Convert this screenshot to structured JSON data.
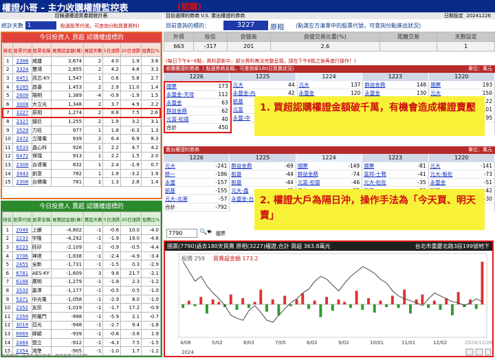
{
  "app": {
    "title": "權證小哥 - 主力收購權證監控表",
    "demo": "(認購)"
  },
  "header": {
    "left": "目錄選權證買賣超統計表",
    "right": "目前選擇的券商 V.S. 賣出權證的券商",
    "date_label": "日期設定",
    "date": "20241226"
  },
  "controls": {
    "days_label": "統計天數",
    "days_value": "1",
    "days_hint": "點選股票代號，可查詢分點買賣資料)",
    "query_label": "目前查詢的標的：",
    "query_code": "3227",
    "query_name": "原相",
    "query_hint": "(點選左方清單中的股票代號，可查詢分點進出狀況)"
  },
  "buy_panel": {
    "title": "今日投資人 買超 認購權證標的",
    "headers": [
      "排名",
      "股票代號",
      "股票名稱",
      "買賣超金額(萬)",
      "買超天數",
      "5日漲跌",
      "20日漲跌",
      "但賣比%"
    ],
    "rows": [
      [
        "1",
        "2388",
        "威盛",
        "3,674",
        "2",
        "4.0",
        "1.9",
        "3.6"
      ],
      [
        "2",
        "3324",
        "雙鴻",
        "2,855",
        "2",
        "4.2",
        "4.8",
        "3.3"
      ],
      [
        "3",
        "6451",
        "訊芯-KY",
        "1,547",
        "1",
        "0.6",
        "5.8",
        "2.7"
      ],
      [
        "4",
        "6285",
        "啟碁",
        "1,453",
        "2",
        "2.9",
        "11.0",
        "1.4"
      ],
      [
        "5",
        "2609",
        "陽明",
        "1,389",
        "-4",
        "-0.9",
        "-1.9",
        "1.5"
      ],
      [
        "6",
        "3008",
        "大立光",
        "1,348",
        "2",
        "3.7",
        "4.9",
        "2.2"
      ],
      [
        "7",
        "3227",
        "原相",
        "1,274",
        "2",
        "8.8",
        "7.5",
        "2.6"
      ],
      [
        "8",
        "2327",
        "國巨",
        "1,255",
        "2",
        "1.9",
        "3.2",
        "3.1"
      ],
      [
        "9",
        "3529",
        "力旺",
        "977",
        "1",
        "1.8",
        "-0.3",
        "1.3"
      ],
      [
        "10",
        "2472",
        "立隆電",
        "939",
        "2",
        "6.4",
        "6.9",
        "8.3"
      ],
      [
        "11",
        "6533",
        "晶心科",
        "926",
        "1",
        "2.2",
        "4.7",
        "4.2"
      ],
      [
        "12",
        "6472",
        "保瑞",
        "913",
        "1",
        "2.2",
        "1.5",
        "2.0"
      ],
      [
        "13",
        "2308",
        "台達電",
        "832",
        "1",
        "2.4",
        "-1.9",
        "0.7"
      ],
      [
        "14",
        "3443",
        "創意",
        "782",
        "1",
        "1.9",
        "-3.2",
        "1.9"
      ],
      [
        "15",
        "2308",
        "台積電",
        "781",
        "1",
        "1.3",
        "2.8",
        "1.4"
      ]
    ]
  },
  "sell_panel": {
    "title": "今日投資人 賣超 認購權證標的",
    "headers": [
      "排名",
      "股票代號",
      "股票名稱",
      "買賣超金額(萬)",
      "賣超天數",
      "5日漲跌",
      "20日漲跌",
      "但賣比%"
    ],
    "rows": [
      [
        "1",
        "2049",
        "上銀",
        "-4,802",
        "-1",
        "-0.6",
        "10.0",
        "-4.0"
      ],
      [
        "2",
        "2233",
        "宇隆",
        "-4,292",
        "-1",
        "-1.9",
        "19.0",
        "-4.6"
      ],
      [
        "3",
        "6223",
        "旺矽",
        "-2,109",
        "-1",
        "-0.9",
        "-0.5",
        "-4.4"
      ],
      [
        "4",
        "3706",
        "神達",
        "-1,838",
        "-1",
        "-2.4",
        "-4.9",
        "-3.4"
      ],
      [
        "5",
        "2455",
        "全新",
        "-1,731",
        "-1",
        "-1.5",
        "0.3",
        "-2.9"
      ],
      [
        "6",
        "6781",
        "AES-KY",
        "-1,609",
        "3",
        "9.8",
        "21.7",
        "-2.1"
      ],
      [
        "7",
        "6188",
        "廣明",
        "-1,279",
        "-1",
        "-1.8",
        "2.3",
        "-1.2"
      ],
      [
        "8",
        "3533",
        "嘉澤",
        "-1,177",
        "-1",
        "-0.5",
        "0.5",
        "-1.0"
      ],
      [
        "9",
        "5371",
        "中光電",
        "-1,058",
        "-1",
        "-2.9",
        "8.0",
        "-1.0"
      ],
      [
        "10",
        "2352",
        "友訊",
        "-1,019",
        "-1",
        "-1.7",
        "17.2",
        "-0.9"
      ],
      [
        "11",
        "2359",
        "所羅門",
        "-998",
        "-1",
        "-5.9",
        "2.1",
        "-0.7"
      ],
      [
        "12",
        "3019",
        "亞光",
        "-948",
        "-1",
        "-2.7",
        "9.4",
        "-1.8"
      ],
      [
        "13",
        "6669",
        "緯穎",
        "-939",
        "-1",
        "-0.6",
        "-3.8",
        "1.9"
      ],
      [
        "14",
        "2464",
        "盟立",
        "-912",
        "-1",
        "-4.3",
        "7.5",
        "-1.5"
      ],
      [
        "15",
        "2354",
        "鴻準",
        "-905",
        "-1",
        "-1.0",
        "1.7",
        "-1.2"
      ]
    ]
  },
  "summary": {
    "headers": [
      "外資",
      "投信",
      "自營商",
      "自營交易比重(%)",
      "距離交易",
      "天數設定"
    ],
    "values": [
      "663",
      "-317",
      "201",
      "2.6",
      "",
      "1"
    ]
  },
  "info_line": "(每日下午4~6點，資料更新中，部分資料無法完整呈現，請在下午6點之後再進行操作！)",
  "buy_brokers": {
    "title": "收購權證的券商",
    "subtitle": "( 點選券商名稱，可查詢單180日買賣狀況)",
    "unit": "單位：萬元",
    "dates": [
      "1226",
      "1225",
      "1224",
      "1223",
      "1220"
    ],
    "cols": [
      [
        [
          "國票",
          "173"
        ],
        [
          "永豐金-天母",
          "112"
        ],
        [
          "永豐金",
          "63"
        ],
        [
          "群益金鼎",
          "62"
        ],
        [
          "元富-松德",
          "40"
        ],
        [
          "合計",
          "450"
        ]
      ],
      [
        [
          "元大",
          "44"
        ],
        [
          "永豐金-內",
          "42"
        ],
        [
          "凱基",
          "41"
        ],
        [
          "元富",
          "38"
        ],
        [
          "永豐-中",
          "33"
        ]
      ],
      [
        [
          "元大",
          "137"
        ],
        [
          "永豐金",
          "120"
        ],
        [
          "凱基",
          "110"
        ],
        [
          "國票",
          "96"
        ],
        [
          "元富",
          "80"
        ]
      ],
      [
        [
          "群益金鼎",
          "148"
        ],
        [
          "永豐金",
          "130"
        ],
        [
          "國票",
          "118"
        ],
        [
          "元大",
          "99"
        ],
        [
          "凱基",
          "88"
        ]
      ],
      [
        [
          "國票",
          "193"
        ],
        [
          "元大",
          "150"
        ],
        [
          "群益",
          "122"
        ],
        [
          "永豐",
          "101"
        ],
        [
          "凱基",
          "95"
        ]
      ]
    ]
  },
  "sell_brokers": {
    "title": "賣出權證的券商",
    "unit": "單位：萬元",
    "dates": [
      "1226",
      "1225",
      "1224",
      "1223",
      "1220"
    ],
    "cols": [
      [
        [
          "元大",
          "-241"
        ],
        [
          "統一",
          "-186"
        ],
        [
          "永豐",
          "-157"
        ],
        [
          "凱基",
          "-155"
        ],
        [
          "元大-北港",
          "-57"
        ],
        [
          "合計",
          "-792"
        ]
      ],
      [
        [
          "群益金鼎",
          "-69"
        ],
        [
          "凱基",
          "-44"
        ],
        [
          "凱基",
          "-44"
        ],
        [
          "元大-鑫",
          "-41"
        ],
        [
          "永豐金-台",
          "-30"
        ]
      ],
      [
        [
          "國票",
          "-149"
        ],
        [
          "群益金鼎",
          "-74"
        ],
        [
          "元富-松德",
          "-46"
        ],
        [
          "元大",
          "-35"
        ],
        [
          "凱基",
          "-28"
        ]
      ],
      [
        [
          "國票",
          "-81"
        ],
        [
          "富邦-士賢",
          "-41"
        ],
        [
          "元大-松佐",
          "-35"
        ],
        [
          "凱基",
          "-30"
        ],
        [
          "永豐金",
          "-22"
        ]
      ],
      [
        [
          "元大",
          "-141"
        ],
        [
          "元大-板佐",
          "-73"
        ],
        [
          "永豐金",
          "-51"
        ],
        [
          "凱基",
          "-42"
        ],
        [
          "國票",
          "-30"
        ]
      ]
    ]
  },
  "callouts": {
    "one": "1. 買超認購權證金額破千萬，有機會造成權證賣壓",
    "two": "2.  權證大戶為隔日沖，操作手法為「今天買、明天賣」"
  },
  "search": {
    "value": "7790",
    "label": "國票"
  },
  "chart": {
    "title": "國票(7790)過去180天買賣 原相(3227)權證,合計  買超 363.8萬元",
    "address": "台北市重慶北路3段199號地下",
    "legend_stock": "股價 259",
    "legend_amount": "買賣超金額 173.2",
    "year": "2024",
    "x_labels": [
      "4/08",
      "5/02",
      "6/03",
      "7/05",
      "8/02",
      "9/02",
      "10/01",
      "11/01",
      "12/02",
      "2024/12/26"
    ]
  },
  "footer": "免責聲明：此資料僅供參考，使用者應自行判斷",
  "colors": {
    "topbar": "#0a2a8a",
    "buy": "#e1413a",
    "sell": "#2b8a2b",
    "callout": "#f7f238",
    "highlight": "#e01818"
  },
  "chart_data": {
    "type": "bar",
    "series": [
      {
        "name": "買賣超金額",
        "values": [
          -20,
          15,
          -10,
          30,
          -50,
          20,
          10,
          -15,
          40,
          -30,
          25,
          -20,
          10,
          60,
          -40,
          20,
          -60,
          35,
          -10,
          20,
          45,
          -25,
          15,
          -70,
          30,
          -35,
          20,
          10,
          -20,
          55,
          -30,
          25,
          -45,
          15,
          -15,
          35,
          -20,
          60,
          -50,
          20,
          40,
          -20,
          15,
          -30,
          25,
          -60,
          50,
          -15,
          20,
          -25,
          173.2
        ]
      },
      {
        "name": "股價",
        "values": [
          300,
          290,
          280,
          285,
          275,
          268,
          262,
          255,
          245,
          242,
          240,
          250,
          255,
          248,
          240,
          238,
          245,
          252,
          258,
          262,
          268,
          272,
          280,
          285,
          282,
          276,
          270,
          278,
          285,
          290,
          295,
          292,
          288,
          282,
          278,
          270,
          265,
          262,
          260,
          258,
          255,
          262,
          268,
          265,
          262,
          259,
          258,
          255,
          258,
          262,
          259
        ]
      }
    ],
    "current_stock_price": 259
  }
}
